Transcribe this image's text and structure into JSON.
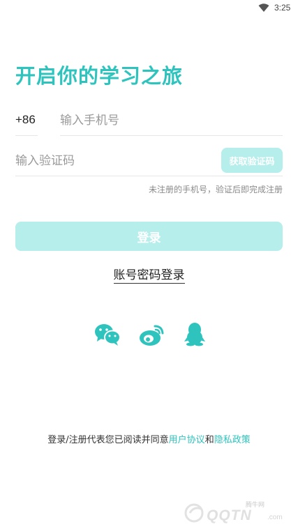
{
  "status_bar": {
    "time": "3:25",
    "wifi_icon": "wifi-icon"
  },
  "title": "开启你的学习之旅",
  "phone": {
    "country_code": "+86",
    "placeholder": "输入手机号",
    "value": ""
  },
  "code": {
    "placeholder": "输入验证码",
    "value": "",
    "get_code_label": "获取验证码"
  },
  "hint": "未注册的手机号，验证后即完成注册",
  "login_button": "登录",
  "password_login": "账号密码登录",
  "social_login": [
    {
      "name": "wechat-icon"
    },
    {
      "name": "weibo-icon"
    },
    {
      "name": "qq-icon"
    }
  ],
  "agreement": {
    "prefix": "登录/注册代表您已阅读并同意",
    "user_agreement": "用户协议",
    "and": "和",
    "privacy_policy": "隐私政策"
  },
  "watermark": {
    "small_text": "腾牛网",
    "logo_text": "QQTN",
    "suffix": ".com"
  },
  "colors": {
    "accent": "#2ec4bd",
    "button_disabled": "#b6eeeb",
    "divider": "#e6e6e6"
  }
}
